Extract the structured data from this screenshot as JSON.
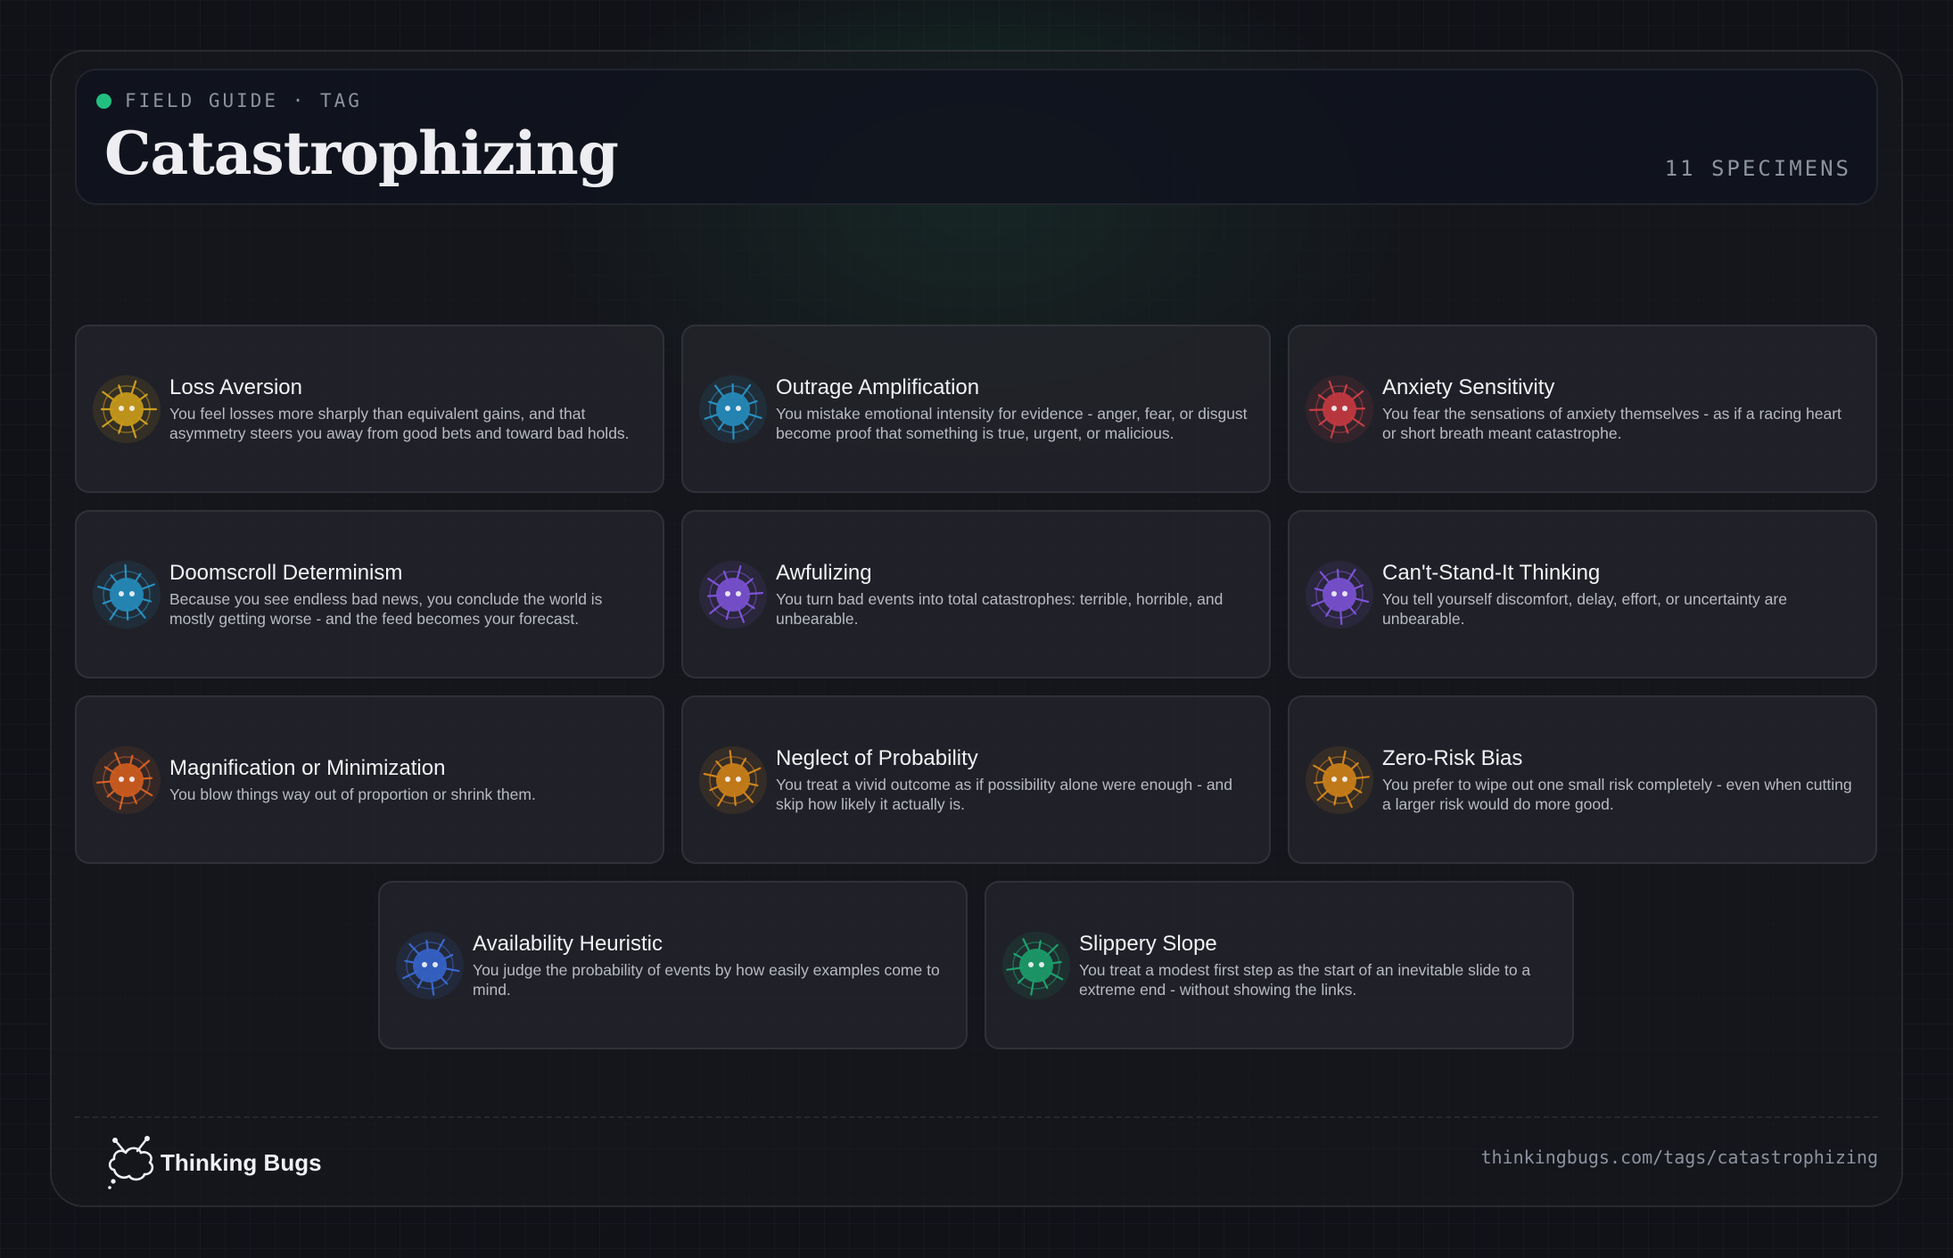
{
  "header": {
    "eyebrow": "FIELD GUIDE · TAG",
    "title": "Catastrophizing",
    "count": "11 SPECIMENS"
  },
  "cards": [
    {
      "title": "Loss Aversion",
      "desc": "You feel losses more sharply than equivalent gains, and that asymmetry steers you away from good bets and toward bad holds.",
      "icon": "bug-yellow-icon",
      "color": "#e6b21e"
    },
    {
      "title": "Outrage Amplification",
      "desc": "You mistake emotional intensity for evidence - anger, fear, or disgust become proof that something is true, urgent, or malicious.",
      "icon": "bug-blue-icon",
      "color": "#2a9fd6"
    },
    {
      "title": "Anxiety Sensitivity",
      "desc": "You fear the sensations of anxiety themselves - as if a racing heart or short breath meant catastrophe.",
      "icon": "bug-red-icon",
      "color": "#e0424a"
    },
    {
      "title": "Doomscroll Determinism",
      "desc": "Because you see endless bad news, you conclude the world is mostly getting worse - and the feed becomes your forecast.",
      "icon": "bug-blue-icon",
      "color": "#2a9fd6"
    },
    {
      "title": "Awfulizing",
      "desc": "You turn bad events into total catastrophes: terrible, horrible, and unbearable.",
      "icon": "bug-purple-icon",
      "color": "#8b5cf0"
    },
    {
      "title": "Can't-Stand-It Thinking",
      "desc": "You tell yourself discomfort, delay, effort, or uncertainty are unbearable.",
      "icon": "bug-purple-icon",
      "color": "#8b5cf0"
    },
    {
      "title": "Magnification or Minimization",
      "desc": "You blow things way out of proportion or shrink them.",
      "icon": "bug-orange-icon",
      "color": "#ee6a24"
    },
    {
      "title": "Neglect of Probability",
      "desc": "You treat a vivid outcome as if possibility alone were enough - and skip how likely it actually is.",
      "icon": "bug-amber-icon",
      "color": "#e8931c"
    },
    {
      "title": "Zero-Risk Bias",
      "desc": "You prefer to wipe out one small risk completely - even when cutting a larger risk would do more good.",
      "icon": "bug-amber-icon",
      "color": "#e8931c"
    },
    {
      "title": "Availability Heuristic",
      "desc": "You judge the probability of events by how easily examples come to mind.",
      "icon": "bug-indigo-icon",
      "color": "#3f72e6"
    },
    {
      "title": "Slippery Slope",
      "desc": "You treat a modest first step as the start of an inevitable slide to a extreme end - without showing the links.",
      "icon": "bug-green-icon",
      "color": "#1fb37a"
    }
  ],
  "footer": {
    "brand": "Thinking Bugs",
    "url": "thinkingbugs.com/tags/catastrophizing"
  }
}
